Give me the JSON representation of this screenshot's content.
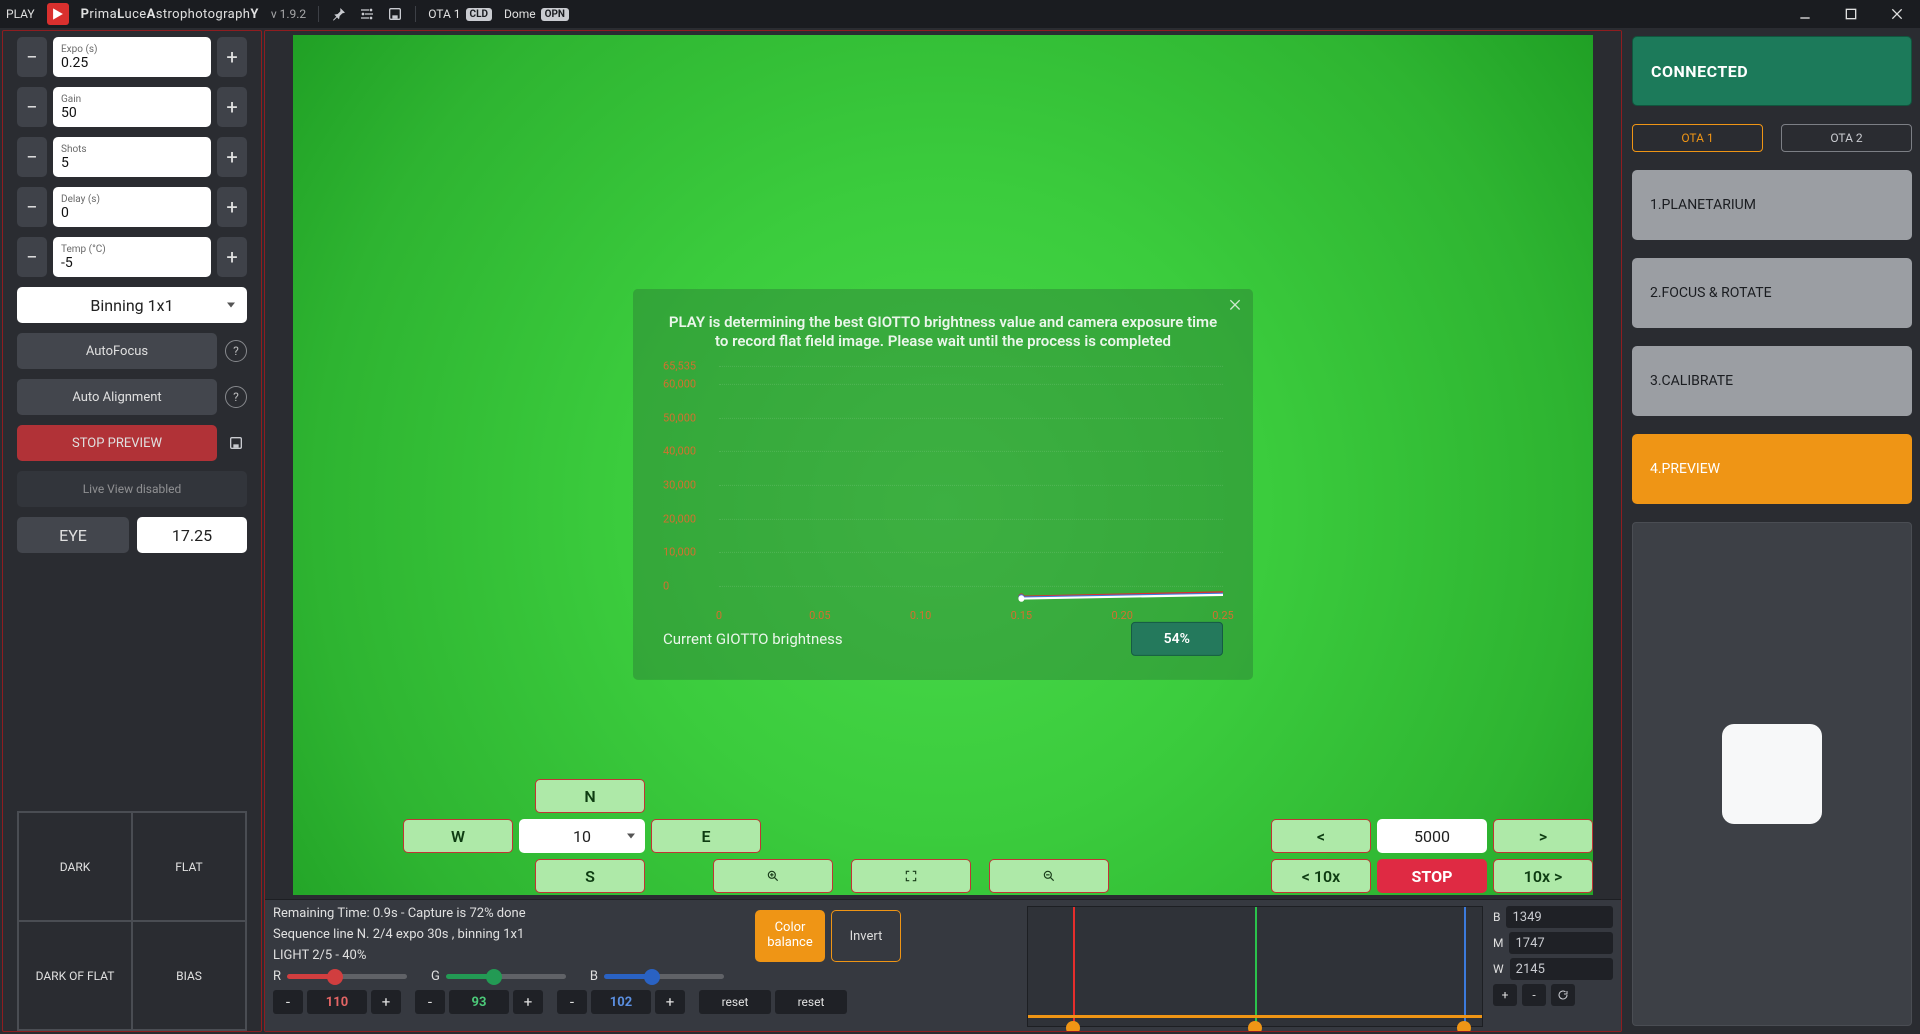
{
  "topbar": {
    "play": "PLAY",
    "appname_html": "PrimaLuceAstrophotographY",
    "version": "v 1.9.2",
    "ota_label": "OTA 1",
    "ota_badge": "CLD",
    "dome_label": "Dome",
    "dome_badge": "OPN"
  },
  "left": {
    "expo_label": "Expo (s)",
    "expo_value": "0.25",
    "gain_label": "Gain",
    "gain_value": "50",
    "shots_label": "Shots",
    "shots_value": "5",
    "delay_label": "Delay (s)",
    "delay_value": "0",
    "temp_label": "Temp (°C)",
    "temp_value": "-5",
    "binning": "Binning 1x1",
    "autofocus": "AutoFocus",
    "autoalign": "Auto Alignment",
    "stoppreview": "STOP PREVIEW",
    "liveview": "Live View disabled",
    "eye": "EYE",
    "eye_val": "17.25",
    "quad": {
      "dark": "DARK",
      "flat": "FLAT",
      "darkofflat": "DARK OF FLAT",
      "bias": "BIAS"
    }
  },
  "dialog": {
    "text": "PLAY is determining the best GIOTTO brightness value and camera exposure time to record flat field image. Please wait until the process is completed",
    "footer_label": "Current GIOTTO brightness",
    "footer_value": "54%"
  },
  "chart_data": {
    "type": "line",
    "title": "",
    "xlabel": "",
    "ylabel": "",
    "ylim": [
      0,
      65535
    ],
    "yticks": [
      0,
      10000,
      20000,
      30000,
      40000,
      50000,
      60000,
      65535
    ],
    "ytick_labels": [
      "0",
      "10,000",
      "20,000",
      "30,000",
      "40,000",
      "50,000",
      "60,000",
      "65,535"
    ],
    "xlim": [
      0,
      0.25
    ],
    "xticks": [
      0,
      0.05,
      0.1,
      0.15,
      0.2,
      0.25
    ],
    "xtick_labels": [
      "0",
      "0.05",
      "0.10",
      "0.15",
      "0.20",
      "0.25"
    ],
    "series": [
      {
        "name": "red",
        "color": "#d9302e",
        "points": [
          [
            0.15,
            2500
          ],
          [
            0.25,
            3700
          ]
        ]
      },
      {
        "name": "blue",
        "color": "#3c7bdc",
        "points": [
          [
            0.15,
            2300
          ],
          [
            0.25,
            3300
          ]
        ]
      },
      {
        "name": "white",
        "color": "#ffffff",
        "points": [
          [
            0.15,
            2000
          ],
          [
            0.25,
            3000
          ]
        ]
      }
    ]
  },
  "vp": {
    "N": "N",
    "S": "S",
    "E": "E",
    "W": "W",
    "speed": "10",
    "foc_val": "5000",
    "lt": "<",
    "gt": ">",
    "lt10": "< 10x",
    "gt10": "10x >",
    "stop": "STOP"
  },
  "bottom": {
    "line1": "Remaining Time: 0.9s  -  Capture is 72% done",
    "line2": "Sequence line N. 2/4 expo 30s , binning 1x1",
    "line3": "LIGHT 2/5 - 40%",
    "colorbalance": "Color balance",
    "invert": "Invert",
    "R": "R",
    "G": "G",
    "B": "B",
    "rval": "110",
    "gval": "93",
    "bval": "102",
    "reset": "reset",
    "b": "B",
    "m": "M",
    "w": "W",
    "bval2": "1349",
    "mval": "1747",
    "wval": "2145"
  },
  "right": {
    "connected": "CONNECTED",
    "ota1": "OTA 1",
    "ota2": "OTA 2",
    "p1": "1.PLANETARIUM",
    "p2": "2.FOCUS & ROTATE",
    "p3": "3.CALIBRATE",
    "p4": "4.PREVIEW"
  }
}
